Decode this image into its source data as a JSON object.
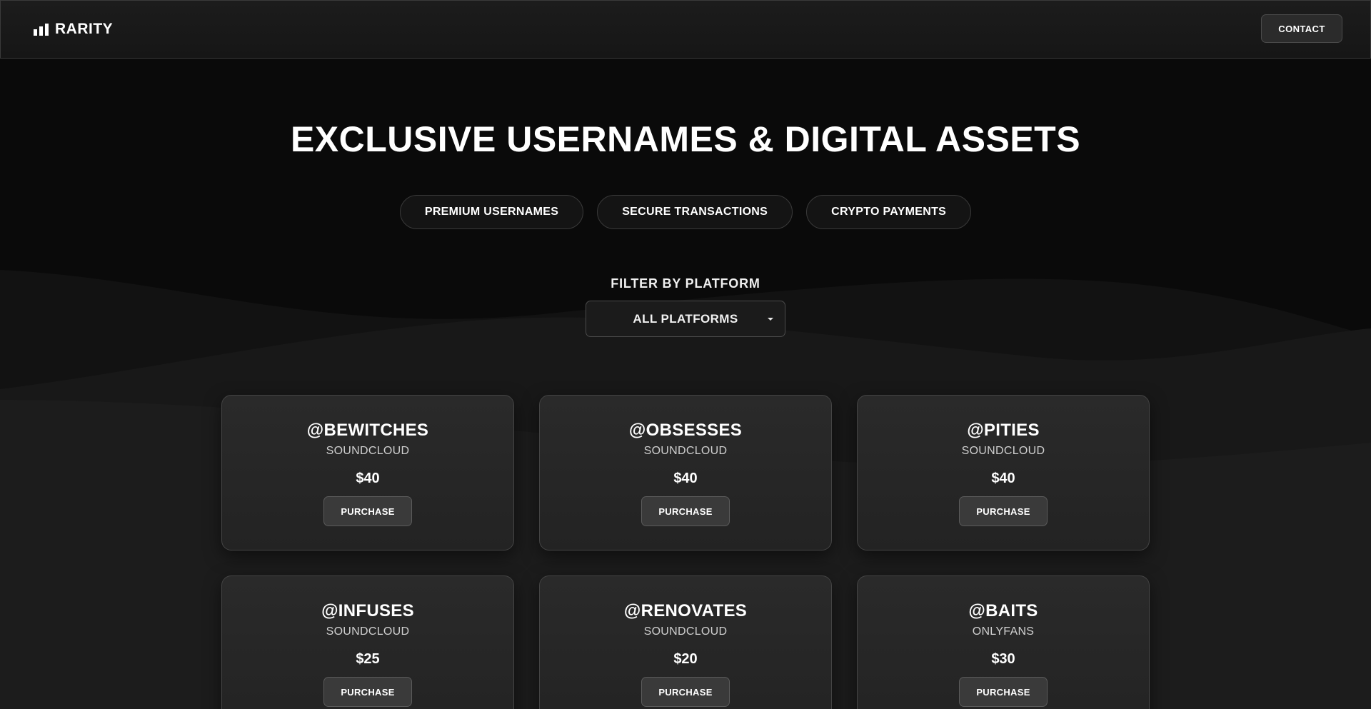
{
  "header": {
    "brand": "RARITY",
    "contact_label": "CONTACT"
  },
  "hero": {
    "title": "EXCLUSIVE USERNAMES & DIGITAL ASSETS",
    "features": [
      "PREMIUM USERNAMES",
      "SECURE TRANSACTIONS",
      "CRYPTO PAYMENTS"
    ]
  },
  "filter": {
    "label": "FILTER BY PLATFORM",
    "selected": "ALL PLATFORMS"
  },
  "listings": [
    {
      "name": "@BEWITCHES",
      "platform": "SOUNDCLOUD",
      "price": "$40",
      "button": "PURCHASE"
    },
    {
      "name": "@OBSESSES",
      "platform": "SOUNDCLOUD",
      "price": "$40",
      "button": "PURCHASE"
    },
    {
      "name": "@PITIES",
      "platform": "SOUNDCLOUD",
      "price": "$40",
      "button": "PURCHASE"
    },
    {
      "name": "@INFUSES",
      "platform": "SOUNDCLOUD",
      "price": "$25",
      "button": "PURCHASE"
    },
    {
      "name": "@RENOVATES",
      "platform": "SOUNDCLOUD",
      "price": "$20",
      "button": "PURCHASE"
    },
    {
      "name": "@BAITS",
      "platform": "ONLYFANS",
      "price": "$30",
      "button": "PURCHASE"
    }
  ],
  "icons": {
    "logo": "bar-chart-icon",
    "filter_caret": "caret-down-icon"
  },
  "colors": {
    "background": "#0a0a0a",
    "surface": "#262626",
    "text": "#ffffff",
    "muted_text": "#d0d0d0"
  }
}
